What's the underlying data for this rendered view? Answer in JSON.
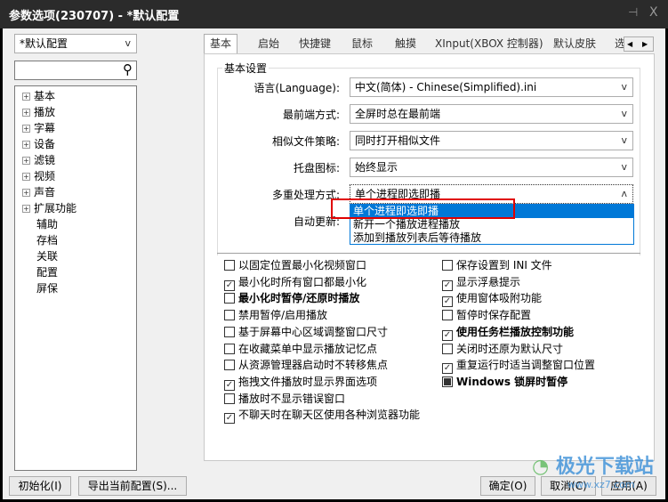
{
  "window": {
    "title": "参数选项(230707) - *默认配置",
    "pin_icon": "pin-icon",
    "close_label": "X"
  },
  "sidebar": {
    "profile": "*默认配置",
    "search_placeholder": "",
    "tree": [
      {
        "label": "基本",
        "expandable": true
      },
      {
        "label": "播放",
        "expandable": true
      },
      {
        "label": "字幕",
        "expandable": true
      },
      {
        "label": "设备",
        "expandable": true
      },
      {
        "label": "滤镜",
        "expandable": true
      },
      {
        "label": "视频",
        "expandable": true
      },
      {
        "label": "声音",
        "expandable": true
      },
      {
        "label": "扩展功能",
        "expandable": true
      },
      {
        "label": "辅助",
        "expandable": false
      },
      {
        "label": "存档",
        "expandable": false
      },
      {
        "label": "关联",
        "expandable": false
      },
      {
        "label": "配置",
        "expandable": false
      },
      {
        "label": "屏保",
        "expandable": false
      }
    ]
  },
  "tabs": [
    "基本",
    "启始",
    "快捷键",
    "鼠标",
    "触摸",
    "XInput(XBOX 控制器)",
    "默认皮肤",
    "选"
  ],
  "group": {
    "title": "基本设置",
    "rows": [
      {
        "label": "语言(Language):",
        "value": "中文(简体) - Chinese(Simplified).ini"
      },
      {
        "label": "最前端方式:",
        "value": "全屏时总在最前端"
      },
      {
        "label": "相似文件策略:",
        "value": "同时打开相似文件"
      },
      {
        "label": "托盘图标:",
        "value": "始终显示"
      },
      {
        "label": "多重处理方式:",
        "value": "单个进程即选即播"
      },
      {
        "label": "自动更新:",
        "value": ""
      }
    ],
    "dropdown_options": [
      "单个进程即选即播",
      "新开一个播放进程播放",
      "添加到播放列表后等待播放"
    ],
    "selected_index": 0,
    "highlight_color": "#0078d7",
    "annotation_color": "#e00000"
  },
  "checkboxes_left": [
    {
      "label": "以固定位置最小化视频窗口",
      "checked": false,
      "bold": false
    },
    {
      "label": "最小化时所有窗口都最小化",
      "checked": true,
      "bold": false
    },
    {
      "label": "最小化时暂停/还原时播放",
      "checked": false,
      "bold": true
    },
    {
      "label": "禁用暂停/启用播放",
      "checked": false,
      "bold": false
    },
    {
      "label": "基于屏幕中心区域调整窗口尺寸",
      "checked": false,
      "bold": false
    },
    {
      "label": "在收藏菜单中显示播放记忆点",
      "checked": false,
      "bold": false
    },
    {
      "label": "从资源管理器启动时不转移焦点",
      "checked": false,
      "bold": false
    },
    {
      "label": "拖拽文件播放时显示界面选项",
      "checked": true,
      "bold": false
    },
    {
      "label": "播放时不显示错误窗口",
      "checked": false,
      "bold": false
    },
    {
      "label": "不聊天时在聊天区使用各种浏览器功能",
      "checked": true,
      "bold": false
    }
  ],
  "checkboxes_right": [
    {
      "label": "保存设置到 INI 文件",
      "checked": false,
      "bold": false
    },
    {
      "label": "显示浮悬提示",
      "checked": true,
      "bold": false
    },
    {
      "label": "使用窗体吸附功能",
      "checked": true,
      "bold": false
    },
    {
      "label": "暂停时保存配置",
      "checked": false,
      "bold": false
    },
    {
      "label": "使用任务栏播放控制功能",
      "checked": true,
      "bold": true
    },
    {
      "label": "关闭时还原为默认尺寸",
      "checked": false,
      "bold": false
    },
    {
      "label": "重复运行时适当调整窗口位置",
      "checked": true,
      "bold": false
    },
    {
      "label": "Windows 锁屏时暂停",
      "checked": "indeterminate",
      "bold": true
    }
  ],
  "buttons": {
    "init": "初始化(I)",
    "export": "导出当前配置(S)...",
    "ok": "确定(O)",
    "cancel": "取消(C)",
    "apply": "应用(A)"
  },
  "watermark": {
    "text": "极光下载站",
    "url": "www.xz7.com"
  }
}
